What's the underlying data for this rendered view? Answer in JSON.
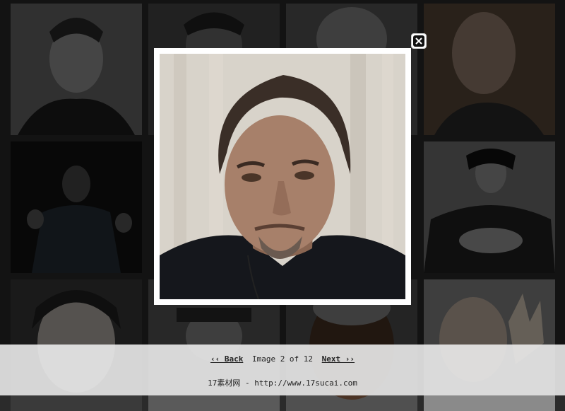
{
  "gallery": {
    "nav": {
      "back": "‹‹ Back",
      "counter": "Image 2 of 12",
      "next": "Next ››"
    },
    "credit": "17素材网 - http://www.17sucai.com"
  },
  "colors": {
    "overlay": "#000000",
    "frame": "#ffffff",
    "footer_bg": "#ebebeb"
  },
  "icons": {
    "close": "close-icon"
  }
}
